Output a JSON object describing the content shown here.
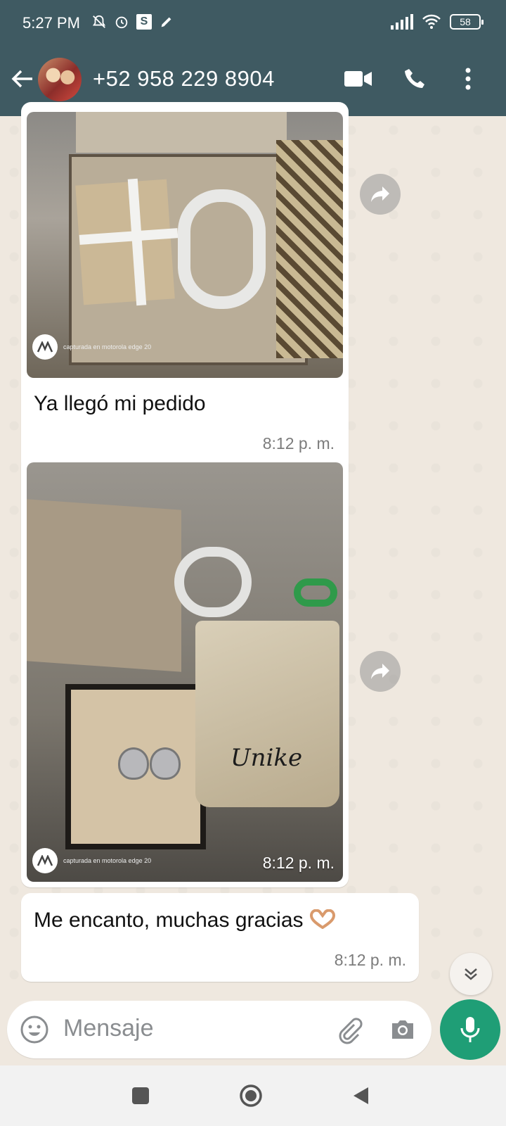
{
  "status_bar": {
    "time": "5:27 PM",
    "s_badge": "S",
    "battery": "58"
  },
  "header": {
    "contact": "+52 958 229 8904"
  },
  "messages": [
    {
      "type": "image",
      "caption": "Ya llegó mi pedido",
      "time": "8:12 p. m.",
      "watermark": "capturada en motorola edge 20"
    },
    {
      "type": "image",
      "time": "8:12 p. m.",
      "watermark": "capturada en motorola edge 20",
      "bag_text": "Unike"
    },
    {
      "type": "text",
      "text": "Me encanto, muchas gracias",
      "emoji": "heart-hands-emoji",
      "time": "8:12 p. m."
    }
  ],
  "composer": {
    "placeholder": "Mensaje"
  },
  "colors": {
    "header": "#3f5a62",
    "chat_bg": "#efe8df",
    "mic": "#1f9e76"
  },
  "icons": [
    "back-arrow-icon",
    "video-call-icon",
    "phone-icon",
    "more-vert-icon",
    "forward-icon",
    "chevron-double-down-icon",
    "emoji-icon",
    "attach-icon",
    "camera-icon",
    "mic-icon",
    "nav-recents-icon",
    "nav-home-icon",
    "nav-back-icon"
  ]
}
